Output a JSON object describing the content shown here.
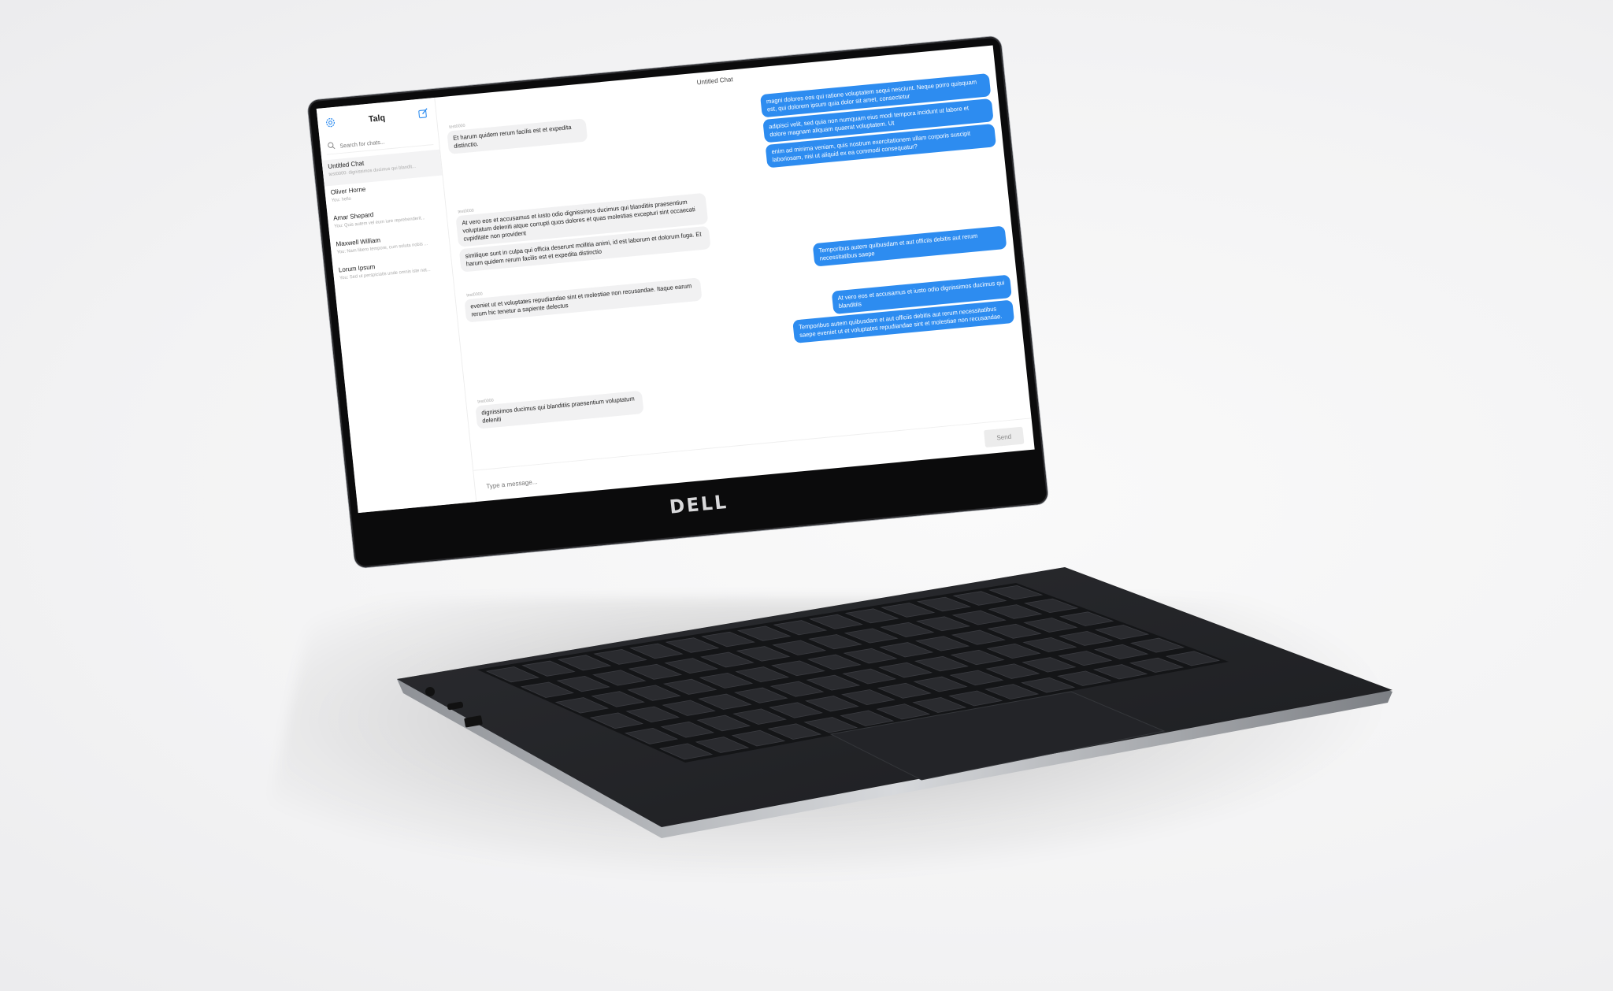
{
  "brand": "DELL",
  "app": {
    "title": "Talq",
    "search_placeholder": "Search for chats..."
  },
  "chats": [
    {
      "name": "Untitled Chat",
      "preview": "test0000: dignissimos ducimus qui blandit..."
    },
    {
      "name": "Oliver Horne",
      "preview": "You: hello"
    },
    {
      "name": "Amar Shepard",
      "preview": "You: Quis autem vel eum iure reprehenderit..."
    },
    {
      "name": "Maxwell William",
      "preview": "You: Nam libero tempore, cum soluta nobis ..."
    },
    {
      "name": "Lorum Ipsum",
      "preview": "You: Sed ut perspiciatis unde omnis iste nat..."
    }
  ],
  "conversation": {
    "title": "Untitled Chat",
    "sender": "test0000",
    "messages": [
      {
        "dir": "in",
        "text": "Et harum quidem rerum facilis est et expedita distinctio."
      },
      {
        "dir": "out",
        "text": "magni dolores eos qui ratione voluptatem sequi nesciunt. Neque porro quisquam est, qui dolorem ipsum quia dolor sit amet, consectetur"
      },
      {
        "dir": "out",
        "text": "adipisci velit, sed quia non numquam eius modi tempora incidunt ut labore et dolore magnam aliquam quaerat voluptatem. Ut"
      },
      {
        "dir": "out",
        "text": "enim ad minima veniam, quis nostrum exercitationem ullam corporis suscipit laboriosam, nisi ut aliquid ex ea commodi consequatur?"
      },
      {
        "dir": "in",
        "text": "At vero eos et accusamus et iusto odio dignissimos ducimus qui blanditiis praesentium voluptatum deleniti atque corrupti quos dolores et quas molestias excepturi sint occaecati cupiditate non provident"
      },
      {
        "dir": "in",
        "text": "similique sunt in culpa qui officia deserunt mollitia animi, id est laborum et dolorum fuga. Et harum quidem rerum facilis est et expedita distinctio"
      },
      {
        "dir": "out",
        "text": "Temporibus autem quibusdam et aut officiis debitis aut rerum necessitatibus saepe"
      },
      {
        "dir": "in",
        "text": "eveniet ut et voluptates repudiandae sint et molestiae non recusandae. Itaque earum rerum hic tenetur a sapiente delectus"
      },
      {
        "dir": "out",
        "text": "At vero eos et accusamus et iusto odio dignissimos ducimus qui blanditiis"
      },
      {
        "dir": "out",
        "text": "Temporibus autem quibusdam et aut officiis debitis aut rerum necessitatibus saepe eveniet ut et voluptates repudiandae sint et molestiae non recusandae."
      },
      {
        "dir": "in",
        "text": "dignissimos ducimus qui blanditiis praesentium voluptatum deleniti"
      }
    ]
  },
  "composer": {
    "placeholder": "Type a message...",
    "send_label": "Send"
  },
  "colors": {
    "accent": "#2d8cf0",
    "incoming_bubble": "#f1f1f2"
  }
}
